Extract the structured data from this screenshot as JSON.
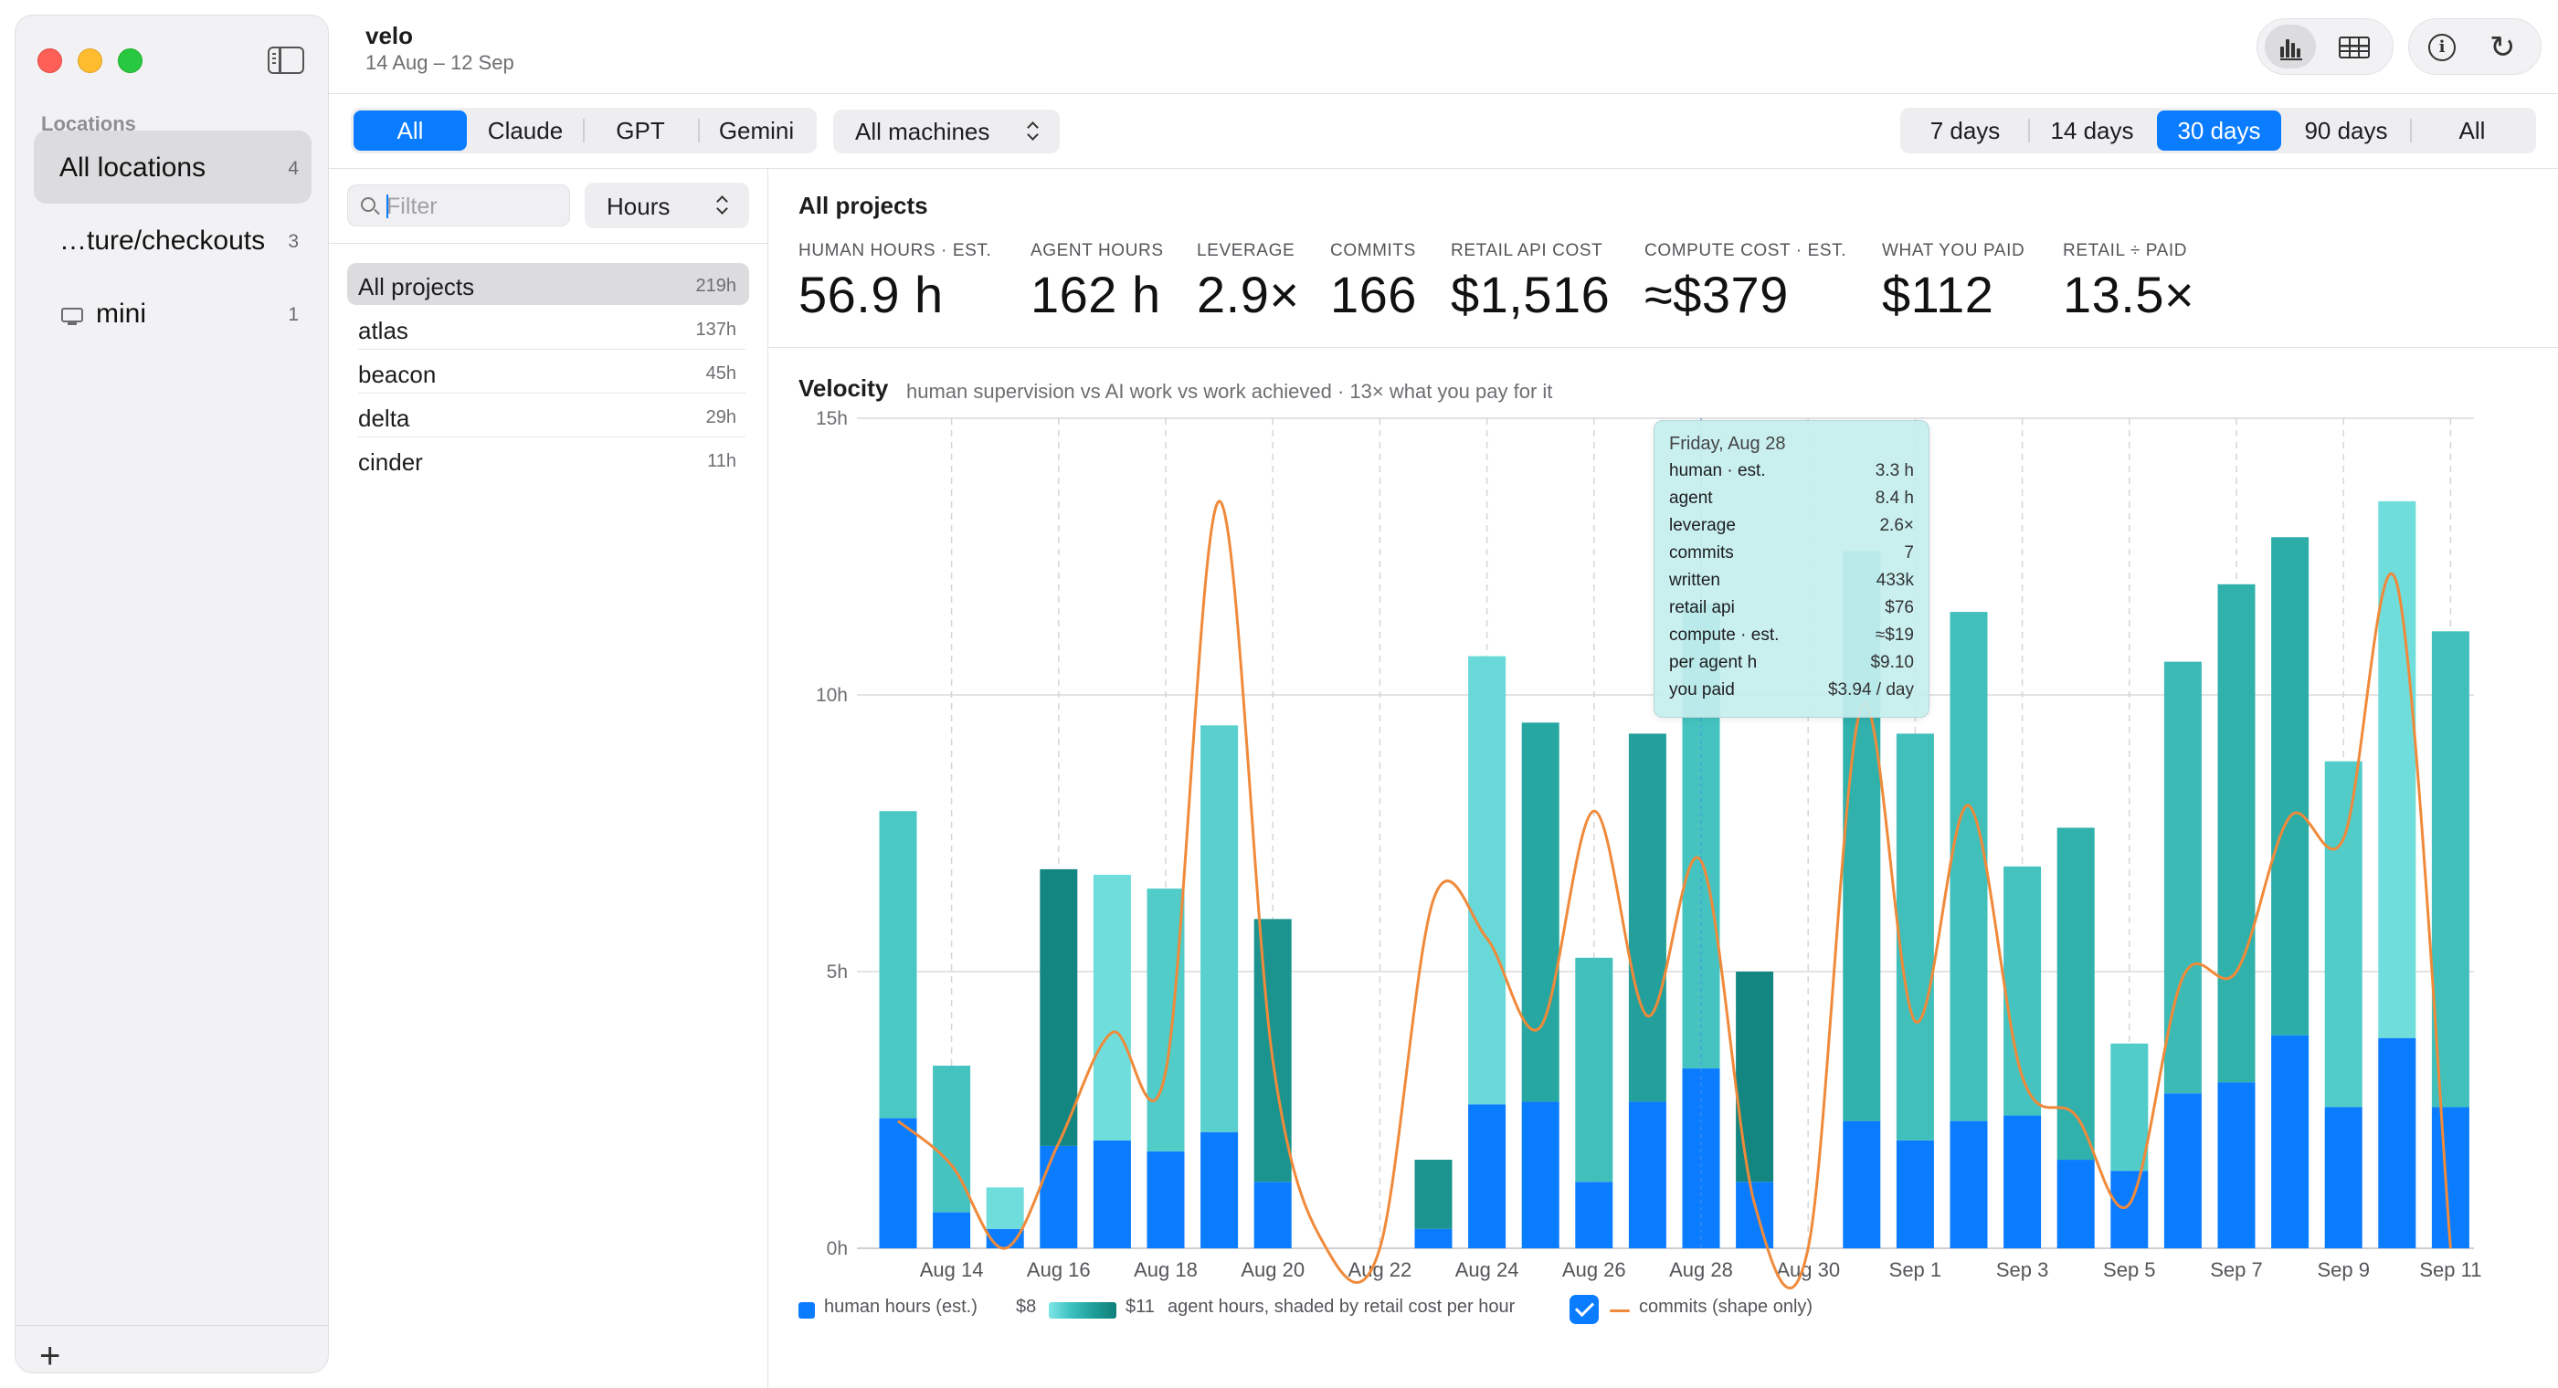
{
  "app": {
    "title": "velo",
    "date_range": "14 Aug – 12 Sep"
  },
  "sidebar": {
    "section_label": "Locations",
    "items": [
      {
        "label": "All locations",
        "count": "4",
        "selected": true
      },
      {
        "label": "…ture/checkouts",
        "count": "3",
        "selected": false
      },
      {
        "label": "mini",
        "count": "1",
        "selected": false,
        "icon": "computer-icon"
      }
    ],
    "add_label": "+"
  },
  "toolbar": {
    "icons": [
      "bar-chart-icon",
      "table-icon",
      "info-icon",
      "refresh-icon"
    ],
    "refresh_glyph": "↻",
    "info_glyph": "i"
  },
  "provider_filter": {
    "options": [
      "All",
      "Claude",
      "GPT",
      "Gemini"
    ],
    "selected": "All"
  },
  "machines_select": {
    "value": "All machines"
  },
  "range_filter": {
    "options": [
      "7 days",
      "14 days",
      "30 days",
      "90 days",
      "All"
    ],
    "selected": "30 days"
  },
  "projects_panel": {
    "filter_placeholder": "Filter",
    "unit_select": "Hours",
    "projects": [
      {
        "name": "All projects",
        "hours": "219h",
        "selected": true
      },
      {
        "name": "atlas",
        "hours": "137h",
        "selected": false
      },
      {
        "name": "beacon",
        "hours": "45h",
        "selected": false
      },
      {
        "name": "delta",
        "hours": "29h",
        "selected": false
      },
      {
        "name": "cinder",
        "hours": "11h",
        "selected": false
      }
    ]
  },
  "main": {
    "title": "All projects",
    "stats": [
      {
        "label": "HUMAN HOURS · EST.",
        "value": "56.9 h"
      },
      {
        "label": "AGENT HOURS",
        "value": "162 h"
      },
      {
        "label": "LEVERAGE",
        "value": "2.9×"
      },
      {
        "label": "COMMITS",
        "value": "166"
      },
      {
        "label": "RETAIL API COST",
        "value": "$1,516"
      },
      {
        "label": "COMPUTE COST · EST.",
        "value": "≈$379"
      },
      {
        "label": "WHAT YOU PAID",
        "value": "$112"
      },
      {
        "label": "RETAIL ÷ PAID",
        "value": "13.5×"
      }
    ],
    "chart_title": "Velocity",
    "chart_subtitle": "human supervision vs AI work vs work achieved · 13× what you pay for it"
  },
  "chart_data": {
    "type": "bar",
    "stacked": true,
    "y_unit": "h",
    "ylim": [
      0,
      15
    ],
    "y_ticks": [
      "0h",
      "5h",
      "10h",
      "15h"
    ],
    "x_ticks": [
      "Aug 14",
      "Aug 16",
      "Aug 18",
      "Aug 20",
      "Aug 22",
      "Aug 24",
      "Aug 26",
      "Aug 28",
      "Aug 30",
      "Sep 1",
      "Sep 3",
      "Sep 5",
      "Sep 7",
      "Sep 9",
      "Sep 11"
    ],
    "categories": [
      "Aug 13",
      "Aug 14",
      "Aug 15",
      "Aug 16",
      "Aug 17",
      "Aug 18",
      "Aug 19",
      "Aug 20",
      "Aug 21",
      "Aug 22",
      "Aug 23",
      "Aug 24",
      "Aug 25",
      "Aug 26",
      "Aug 27",
      "Aug 28",
      "Aug 29",
      "Aug 30",
      "Aug 31",
      "Sep 1",
      "Sep 2",
      "Sep 3",
      "Sep 4",
      "Sep 5",
      "Sep 6",
      "Sep 7",
      "Sep 8",
      "Sep 9",
      "Sep 10",
      "Sep 11"
    ],
    "series": [
      {
        "name": "human hours (est.)",
        "color": "#0a7cff",
        "values": [
          2.35,
          0.65,
          0.35,
          1.85,
          1.95,
          1.75,
          2.1,
          1.2,
          0,
          0,
          0.35,
          2.6,
          2.65,
          1.2,
          2.65,
          3.25,
          1.2,
          0,
          2.3,
          1.95,
          2.3,
          2.4,
          1.6,
          1.4,
          2.8,
          3.0,
          3.85,
          2.55,
          3.8,
          2.55
        ]
      },
      {
        "name": "agent hours",
        "color_scale": [
          "#7ee6e6",
          "#0f7f7a"
        ],
        "values": [
          5.55,
          2.65,
          0.75,
          5.0,
          4.8,
          4.75,
          7.35,
          4.75,
          0,
          0,
          1.25,
          8.1,
          6.85,
          4.05,
          6.65,
          8.4,
          3.8,
          0,
          10.3,
          7.35,
          9.2,
          4.5,
          6.0,
          2.3,
          7.8,
          9.0,
          9.0,
          6.25,
          9.7,
          8.6
        ]
      },
      {
        "name": "commits (shape only)",
        "color": "#f08a3a",
        "values": [
          2.3,
          1.5,
          0,
          1.9,
          3.9,
          3.2,
          13.5,
          3.4,
          0,
          0,
          6.3,
          5.6,
          4.0,
          7.9,
          4.2,
          7.0,
          0.8,
          0,
          9.8,
          4.1,
          8.0,
          3.1,
          2.4,
          0.8,
          4.9,
          5.0,
          7.8,
          7.4,
          12.0,
          0
        ]
      }
    ],
    "agent_shade": [
      0.35,
      0.4,
      0.1,
      0.95,
      0.1,
      0.3,
      0.25,
      0.85,
      0,
      0,
      0.85,
      0.15,
      0.7,
      0.45,
      0.75,
      0.4,
      0.95,
      0,
      0.6,
      0.45,
      0.45,
      0.4,
      0.6,
      0.3,
      0.5,
      0.6,
      0.65,
      0.3,
      0.1,
      0.45
    ],
    "tooltip": {
      "title": "Friday, Aug 28",
      "rows": [
        {
          "k": "human · est.",
          "v": "3.3 h"
        },
        {
          "k": "agent",
          "v": "8.4 h"
        },
        {
          "k": "leverage",
          "v": "2.6×"
        },
        {
          "k": "commits",
          "v": "7"
        },
        {
          "k": "written",
          "v": "433k"
        },
        {
          "k": "retail api",
          "v": "$76"
        },
        {
          "k": "compute · est.",
          "v": "≈$19"
        },
        {
          "k": "per agent h",
          "v": "$9.10"
        },
        {
          "k": "you paid",
          "v": "$3.94 / day"
        }
      ]
    }
  },
  "legend": {
    "human": "human hours (est.)",
    "scale_min": "$8",
    "scale_max": "$11",
    "agent": "agent hours, shaded by retail cost per hour",
    "commits": "commits (shape only)",
    "commits_checked": true
  }
}
